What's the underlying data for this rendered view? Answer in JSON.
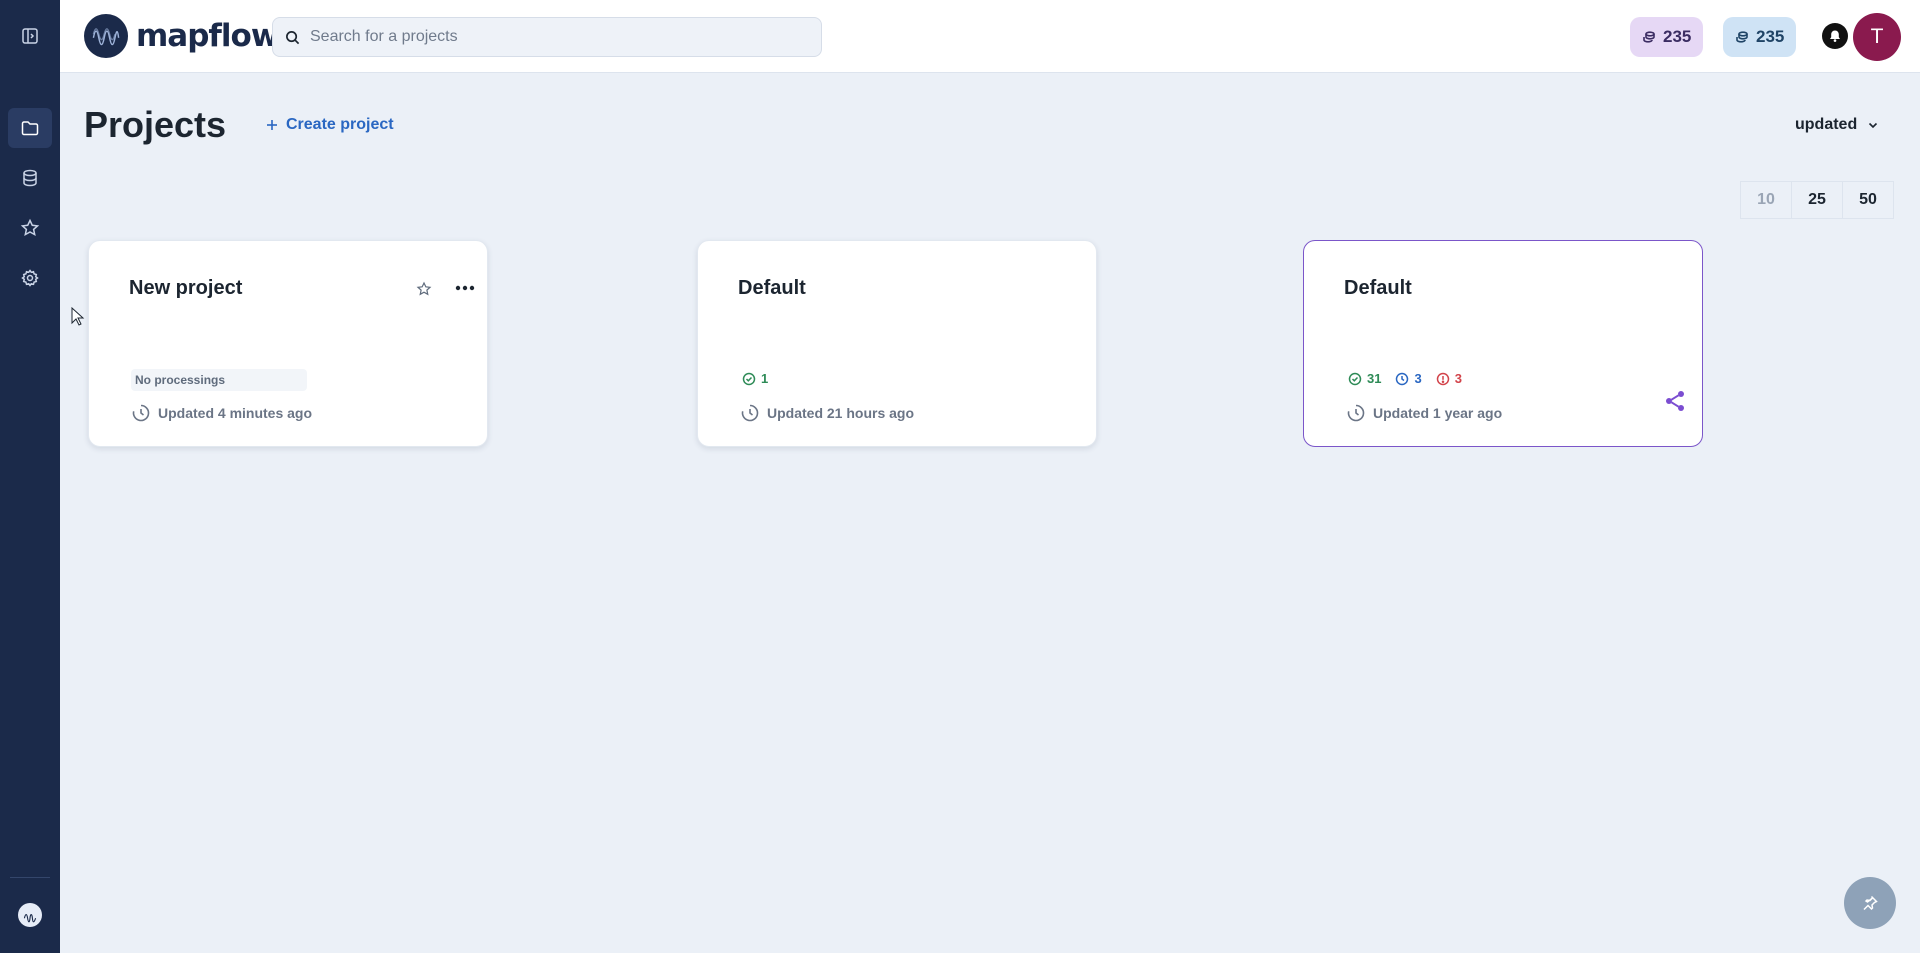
{
  "app": {
    "brand": "mapflow"
  },
  "search": {
    "placeholder": "Search for a projects",
    "value": ""
  },
  "credits": [
    {
      "value": "235",
      "color": "#e6d8f5"
    },
    {
      "value": "235",
      "color": "#cfe3f5"
    }
  ],
  "user": {
    "initial": "T",
    "avatar_color": "#8a1a4e"
  },
  "page": {
    "title": "Projects",
    "create_label": "Create project",
    "sort_label": "updated"
  },
  "pager": [
    "10",
    "25",
    "50"
  ],
  "projects": [
    {
      "title": "New project",
      "no_processings": "No processings",
      "updated": "Updated 4 minutes ago"
    },
    {
      "title": "Default",
      "ok": "1",
      "updated": "Updated 21 hours ago"
    },
    {
      "title": "Default",
      "ok": "31",
      "running": "3",
      "failed": "3",
      "updated": "Updated 1 year ago"
    }
  ],
  "colors": {
    "sidebar": "#1b2a4a",
    "accent": "#2a67c2",
    "selected_border": "#7b56c9",
    "success": "#2e8b57",
    "error": "#d2434a"
  },
  "icons": [
    "sidebar-toggle-icon",
    "folder-icon",
    "database-icon",
    "star-icon",
    "settings-icon",
    "search-icon",
    "coins-icon",
    "bell-icon",
    "plus-icon",
    "chevron-down-icon",
    "more-icon",
    "check-circle-icon",
    "clock-icon",
    "alert-circle-icon",
    "share-icon",
    "pin-icon"
  ]
}
